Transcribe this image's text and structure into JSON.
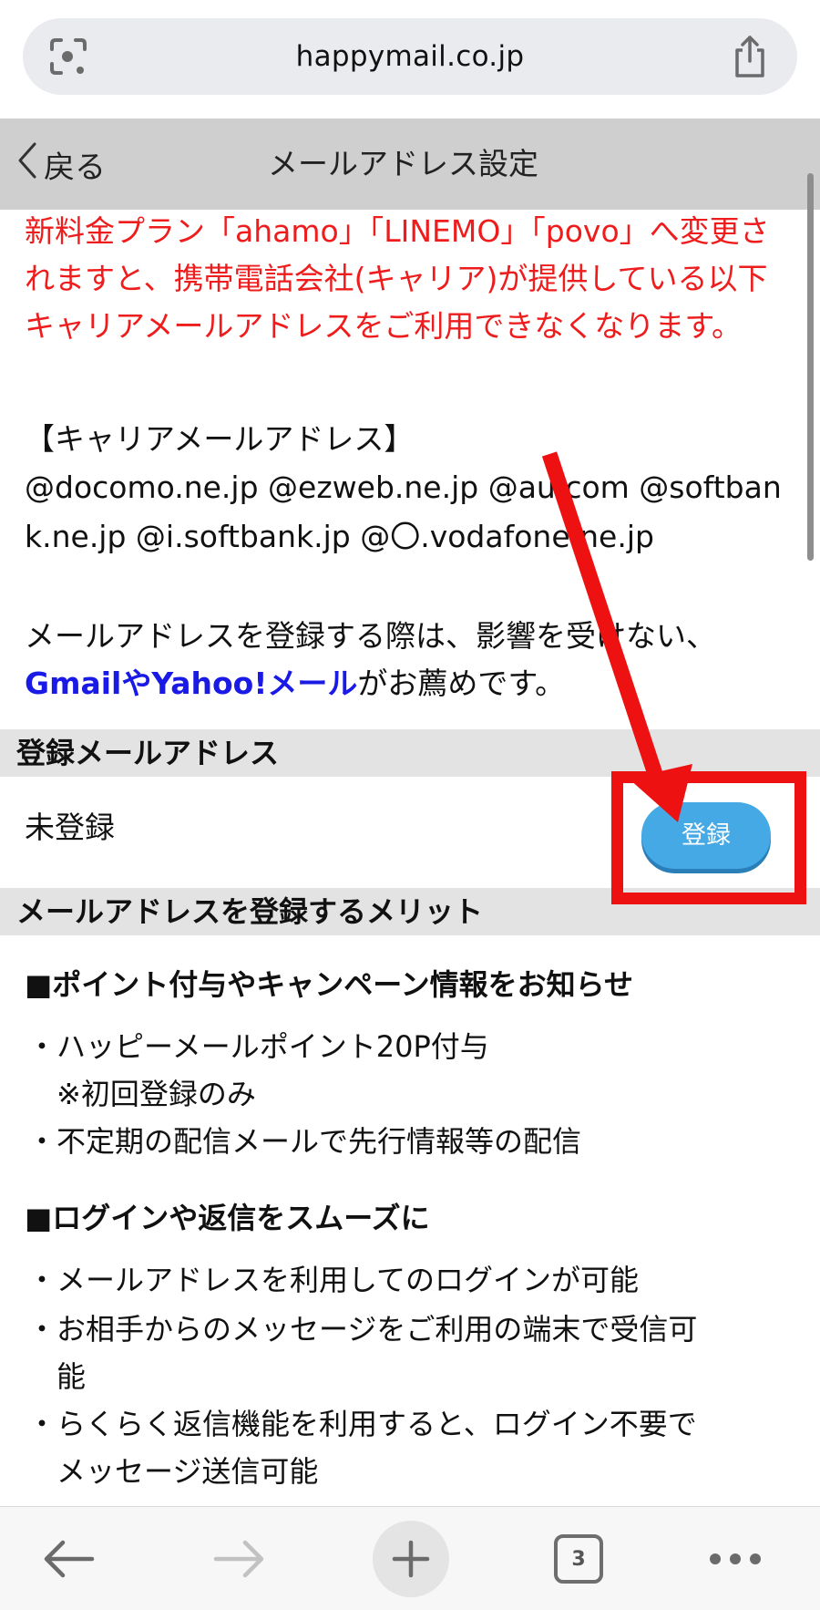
{
  "browser": {
    "url": "happymail.co.jp",
    "lens_icon": "lens-icon",
    "share_icon": "share-icon"
  },
  "header": {
    "back_label": "戻る",
    "title": "メールアドレス設定"
  },
  "warning": {
    "text": "新料金プラン「ahamo」「LINEMO」「povo」へ変更されますと、携帯電話会社(キャリア)が提供している以下キャリアメールアドレスをご利用できなくなります。",
    "color": "#ee1c1c"
  },
  "carrier": {
    "title": "【キャリアメールアドレス】",
    "list": "@docomo.ne.jp @ezweb.ne.jp @au.com @softbank.ne.jp @i.softbank.jp @〇.vodafone.ne.jp"
  },
  "recommend": {
    "before": "メールアドレスを登録する際は、影響を受けない、",
    "highlight": "GmailやYahoo!メール",
    "after": "がお薦めです。",
    "highlight_color": "#1a1ae6"
  },
  "registered": {
    "section_title": "登録メールアドレス",
    "status": "未登録",
    "button_label": "登録",
    "button_color": "#45a9e6"
  },
  "merits": {
    "section_title": "メールアドレスを登録するメリット",
    "groups": [
      {
        "heading": "■ポイント付与やキャンペーン情報をお知らせ",
        "items": [
          "・ハッピーメールポイント20P付与",
          "　※初回登録のみ",
          "・不定期の配信メールで先行情報等の配信"
        ]
      },
      {
        "heading": "■ログインや返信をスムーズに",
        "items": [
          "・メールアドレスを利用してのログインが可能",
          "・お相手からのメッセージをご利用の端末で受信可",
          "　能",
          "・らくらく返信機能を利用すると、ログイン不要で",
          "　メッセージ送信可能"
        ]
      }
    ]
  },
  "toolbar": {
    "tab_count": "3",
    "back_icon": "arrow-left-icon",
    "forward_icon": "arrow-right-icon",
    "new_tab_icon": "plus-icon",
    "tabs_icon": "tabs-icon",
    "more_icon": "more-dots-icon"
  },
  "annotation": {
    "color": "#ee1111"
  }
}
